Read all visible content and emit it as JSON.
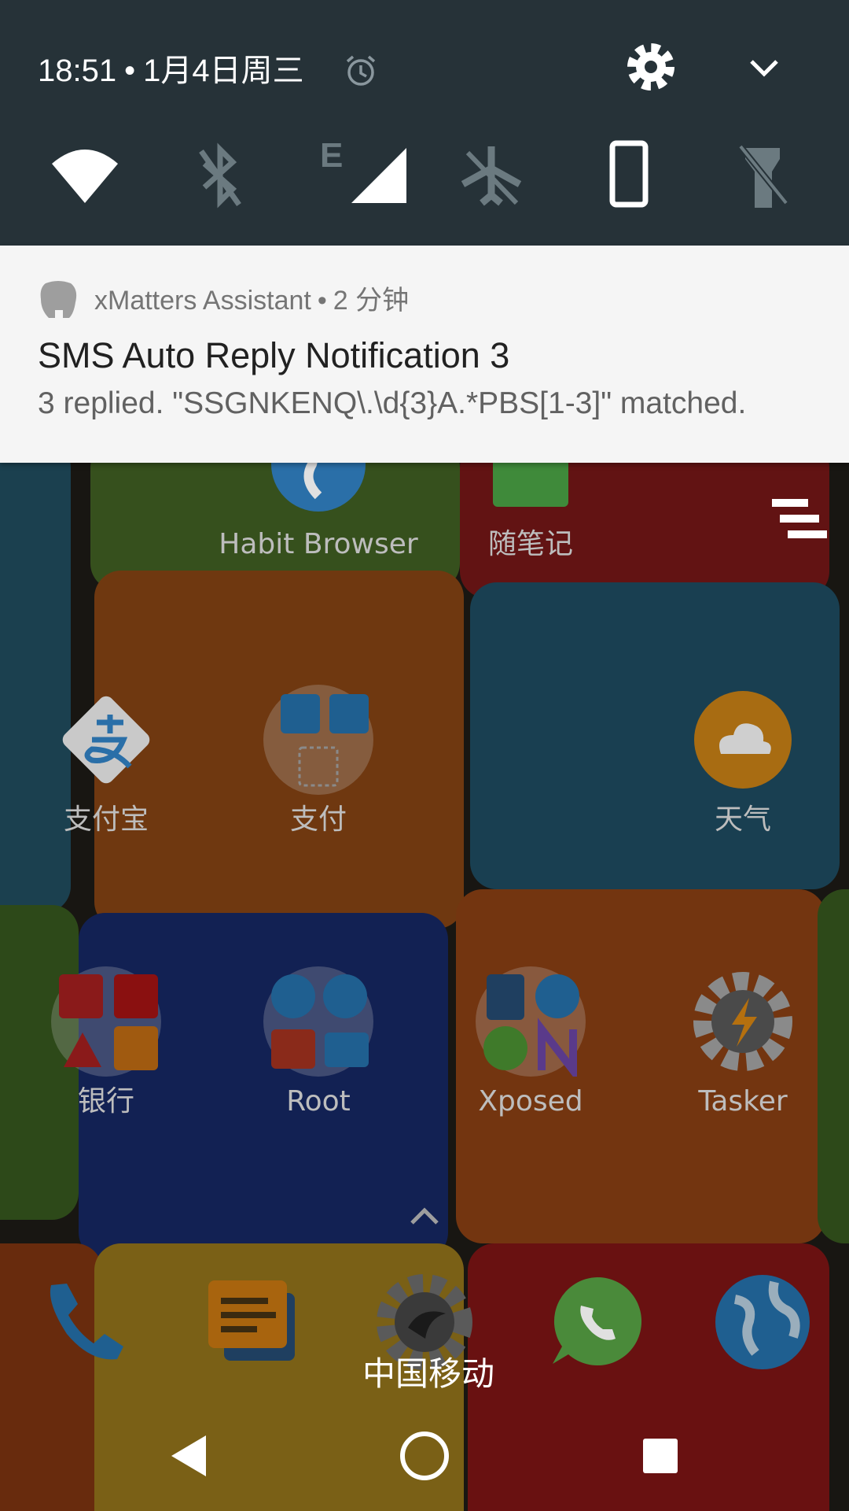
{
  "status": {
    "time": "18:51",
    "separator": "•",
    "date": "1月4日周三"
  },
  "quick_settings": {
    "icons": [
      "alarm-icon",
      "settings-gear-icon",
      "expand-chevron-icon"
    ],
    "tiles": [
      {
        "name": "wifi",
        "icon": "wifi-icon",
        "state": "on"
      },
      {
        "name": "bluetooth",
        "icon": "bluetooth-off-icon",
        "state": "off"
      },
      {
        "name": "mobile-data",
        "icon": "signal-icon",
        "network": "E",
        "state": "on"
      },
      {
        "name": "airplane-mode",
        "icon": "airplane-off-icon",
        "state": "off"
      },
      {
        "name": "auto-rotate",
        "icon": "portrait-phone-icon",
        "state": "on"
      },
      {
        "name": "flashlight",
        "icon": "flashlight-off-icon",
        "state": "off"
      }
    ]
  },
  "notification": {
    "app_name": "xMatters Assistant",
    "separator": "•",
    "time_ago": "2 分钟",
    "title": "SMS Auto Reply Notification 3",
    "body": "3 replied. \"SSGNKENQ\\.\\d{3}A.*PBS[1-3]\" matched."
  },
  "home": {
    "apps_row0": [
      {
        "label": "Habit Browser",
        "icon": "globe-icon"
      },
      {
        "label": "随笔记",
        "icon": "notes-icon"
      }
    ],
    "apps_row1": [
      {
        "label": "支付宝",
        "icon": "alipay-icon"
      },
      {
        "label": "支付",
        "icon": "folder-icon"
      },
      {
        "label": "天气",
        "icon": "cloud-icon"
      }
    ],
    "apps_row2": [
      {
        "label": "银行",
        "icon": "folder-icon"
      },
      {
        "label": "Root",
        "icon": "folder-icon"
      },
      {
        "label": "Xposed",
        "icon": "folder-icon"
      },
      {
        "label": "Tasker",
        "icon": "tasker-gear-icon"
      }
    ],
    "dock": [
      "phone-icon",
      "messages-icon",
      "camera-icon",
      "whatsapp-icon",
      "browser-globe-icon"
    ],
    "carrier": "中国移动"
  },
  "nav": [
    "back-icon",
    "home-icon",
    "recents-icon"
  ]
}
